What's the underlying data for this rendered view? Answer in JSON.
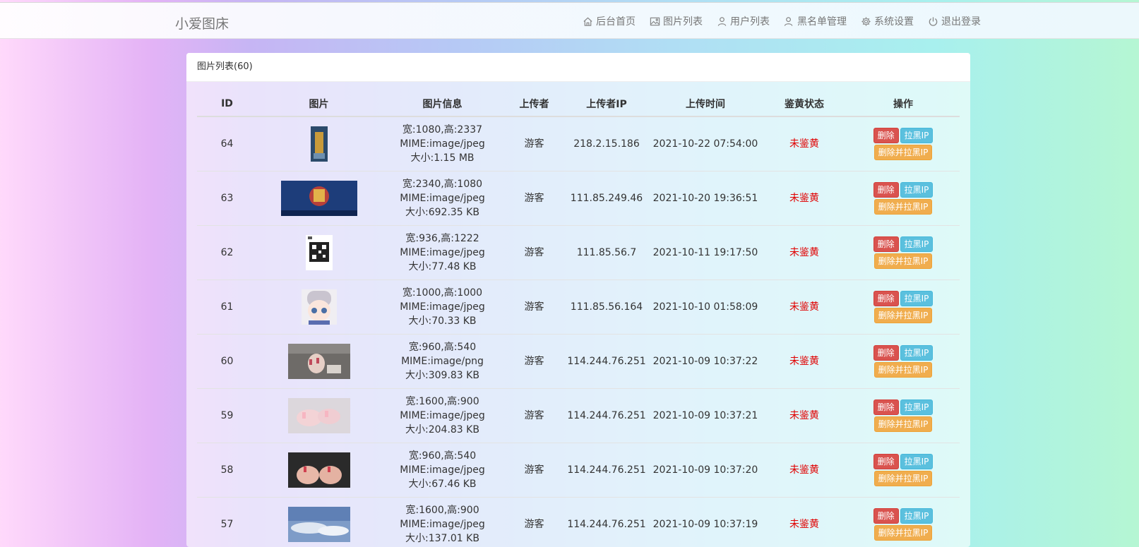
{
  "header": {
    "brand": "小爱图床",
    "nav": [
      {
        "label": "后台首页",
        "icon": "home-icon"
      },
      {
        "label": "图片列表",
        "icon": "image-icon"
      },
      {
        "label": "用户列表",
        "icon": "user-icon"
      },
      {
        "label": "黑名单管理",
        "icon": "user-block-icon"
      },
      {
        "label": "系统设置",
        "icon": "gear-icon"
      },
      {
        "label": "退出登录",
        "icon": "power-icon"
      }
    ]
  },
  "panel": {
    "title": "图片列表(60)",
    "columns": [
      "ID",
      "图片",
      "图片信息",
      "上传者",
      "上传者IP",
      "上传时间",
      "鉴黄状态",
      "操作"
    ],
    "actions": {
      "delete": "删除",
      "ban_ip": "拉黑IP",
      "delete_and_ban": "删除并拉黑IP"
    },
    "rows": [
      {
        "id": "64",
        "dim": "宽:1080,高:2337",
        "mime": "MIME:image/jpeg",
        "size": "大小:1.15 MB",
        "uploader": "游客",
        "ip": "218.2.15.186",
        "time": "2021-10-22 07:54:00",
        "status": "未鉴黄"
      },
      {
        "id": "63",
        "dim": "宽:2340,高:1080",
        "mime": "MIME:image/jpeg",
        "size": "大小:692.35 KB",
        "uploader": "游客",
        "ip": "111.85.249.46",
        "time": "2021-10-20 19:36:51",
        "status": "未鉴黄"
      },
      {
        "id": "62",
        "dim": "宽:936,高:1222",
        "mime": "MIME:image/jpeg",
        "size": "大小:77.48 KB",
        "uploader": "游客",
        "ip": "111.85.56.7",
        "time": "2021-10-11 19:17:50",
        "status": "未鉴黄"
      },
      {
        "id": "61",
        "dim": "宽:1000,高:1000",
        "mime": "MIME:image/jpeg",
        "size": "大小:70.33 KB",
        "uploader": "游客",
        "ip": "111.85.56.164",
        "time": "2021-10-10 01:58:09",
        "status": "未鉴黄"
      },
      {
        "id": "60",
        "dim": "宽:960,高:540",
        "mime": "MIME:image/png",
        "size": "大小:309.83 KB",
        "uploader": "游客",
        "ip": "114.244.76.251",
        "time": "2021-10-09 10:37:22",
        "status": "未鉴黄"
      },
      {
        "id": "59",
        "dim": "宽:1600,高:900",
        "mime": "MIME:image/jpeg",
        "size": "大小:204.83 KB",
        "uploader": "游客",
        "ip": "114.244.76.251",
        "time": "2021-10-09 10:37:21",
        "status": "未鉴黄"
      },
      {
        "id": "58",
        "dim": "宽:960,高:540",
        "mime": "MIME:image/jpeg",
        "size": "大小:67.46 KB",
        "uploader": "游客",
        "ip": "114.244.76.251",
        "time": "2021-10-09 10:37:20",
        "status": "未鉴黄"
      },
      {
        "id": "57",
        "dim": "宽:1600,高:900",
        "mime": "MIME:image/jpeg",
        "size": "大小:137.01 KB",
        "uploader": "游客",
        "ip": "114.244.76.251",
        "time": "2021-10-09 10:37:19",
        "status": "未鉴黄"
      }
    ]
  },
  "colors": {
    "status": "#e00000",
    "delete": "#d9534f",
    "ban": "#5bc0de",
    "delete_ban": "#f0ad4e"
  }
}
